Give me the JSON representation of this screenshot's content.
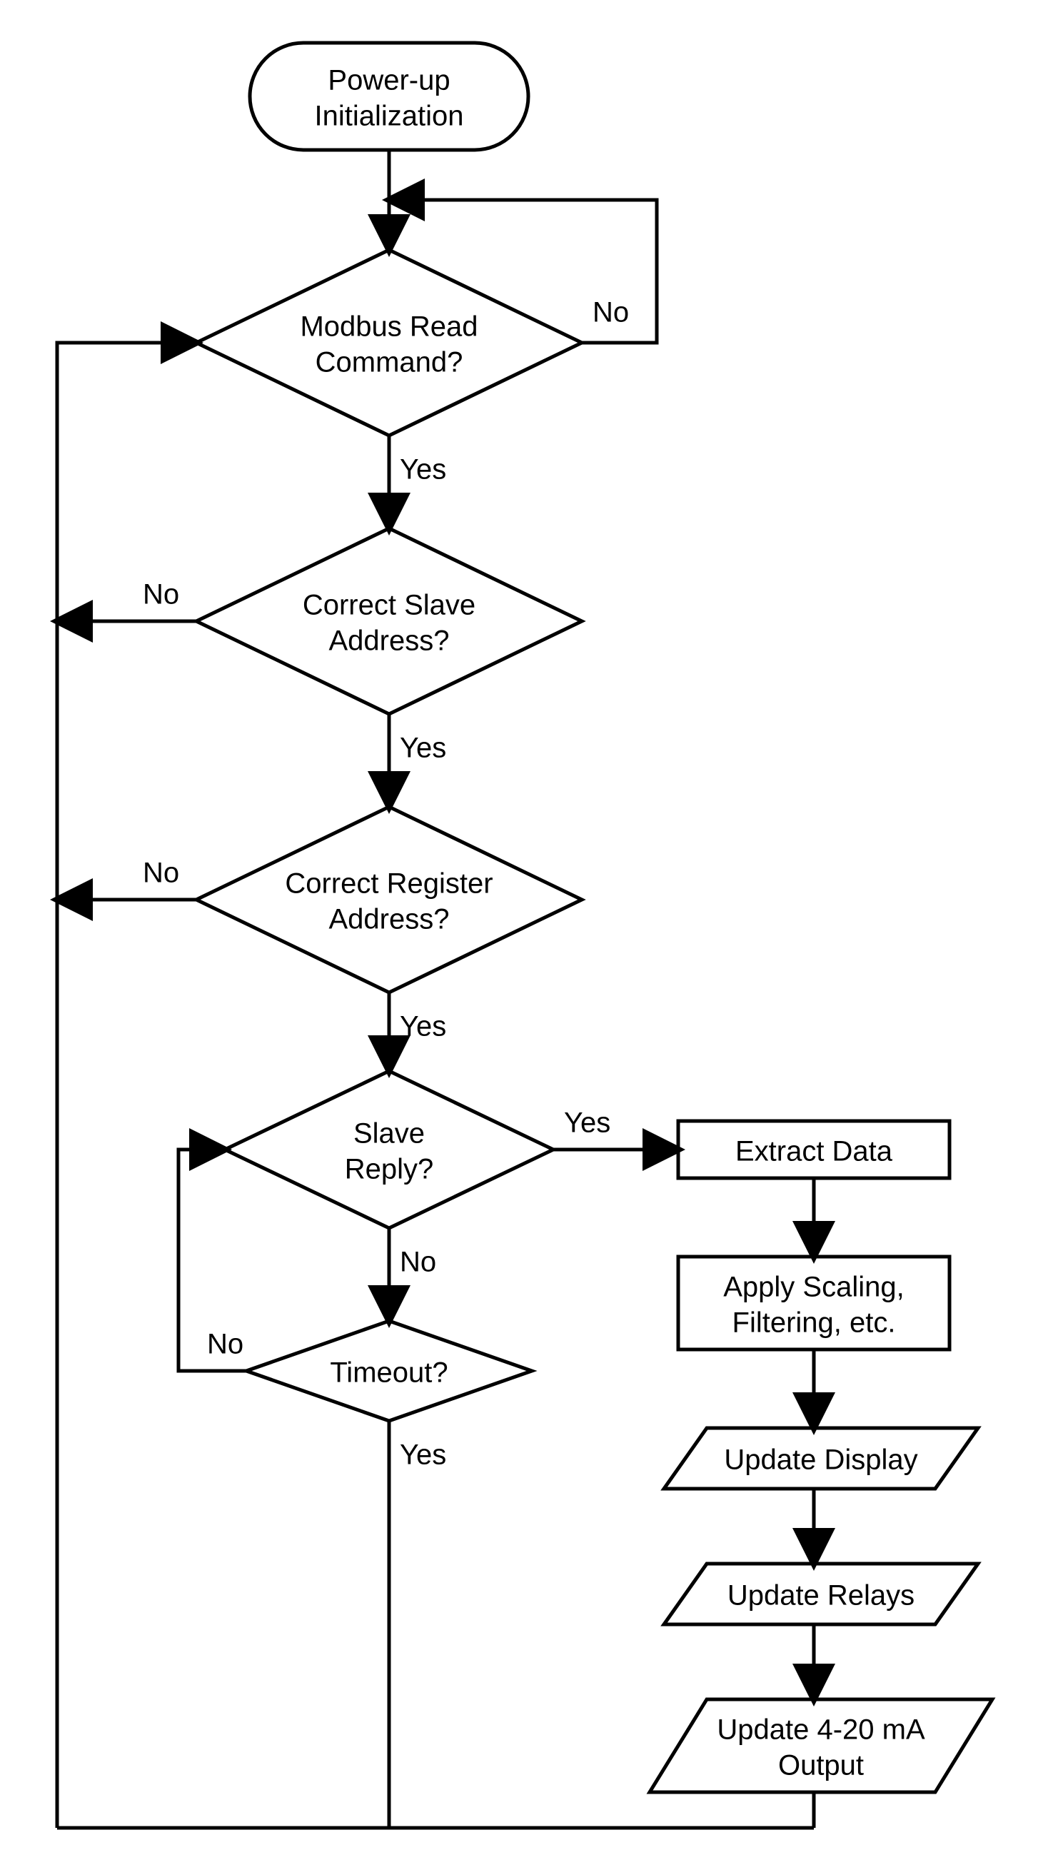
{
  "nodes": {
    "start": {
      "line1": "Power-up",
      "line2": "Initialization"
    },
    "d1": {
      "line1": "Modbus Read",
      "line2": "Command?"
    },
    "d2": {
      "line1": "Correct Slave",
      "line2": "Address?"
    },
    "d3": {
      "line1": "Correct Register",
      "line2": "Address?"
    },
    "d4": {
      "line1": "Slave",
      "line2": "Reply?"
    },
    "d5": {
      "line1": "Timeout?"
    },
    "p1": {
      "line1": "Extract Data"
    },
    "p2": {
      "line1": "Apply Scaling,",
      "line2": "Filtering, etc."
    },
    "p3": {
      "line1": "Update Display"
    },
    "p4": {
      "line1": "Update Relays"
    },
    "p5": {
      "line1": "Update 4-20 mA",
      "line2": "Output"
    }
  },
  "labels": {
    "yes": "Yes",
    "no": "No"
  }
}
